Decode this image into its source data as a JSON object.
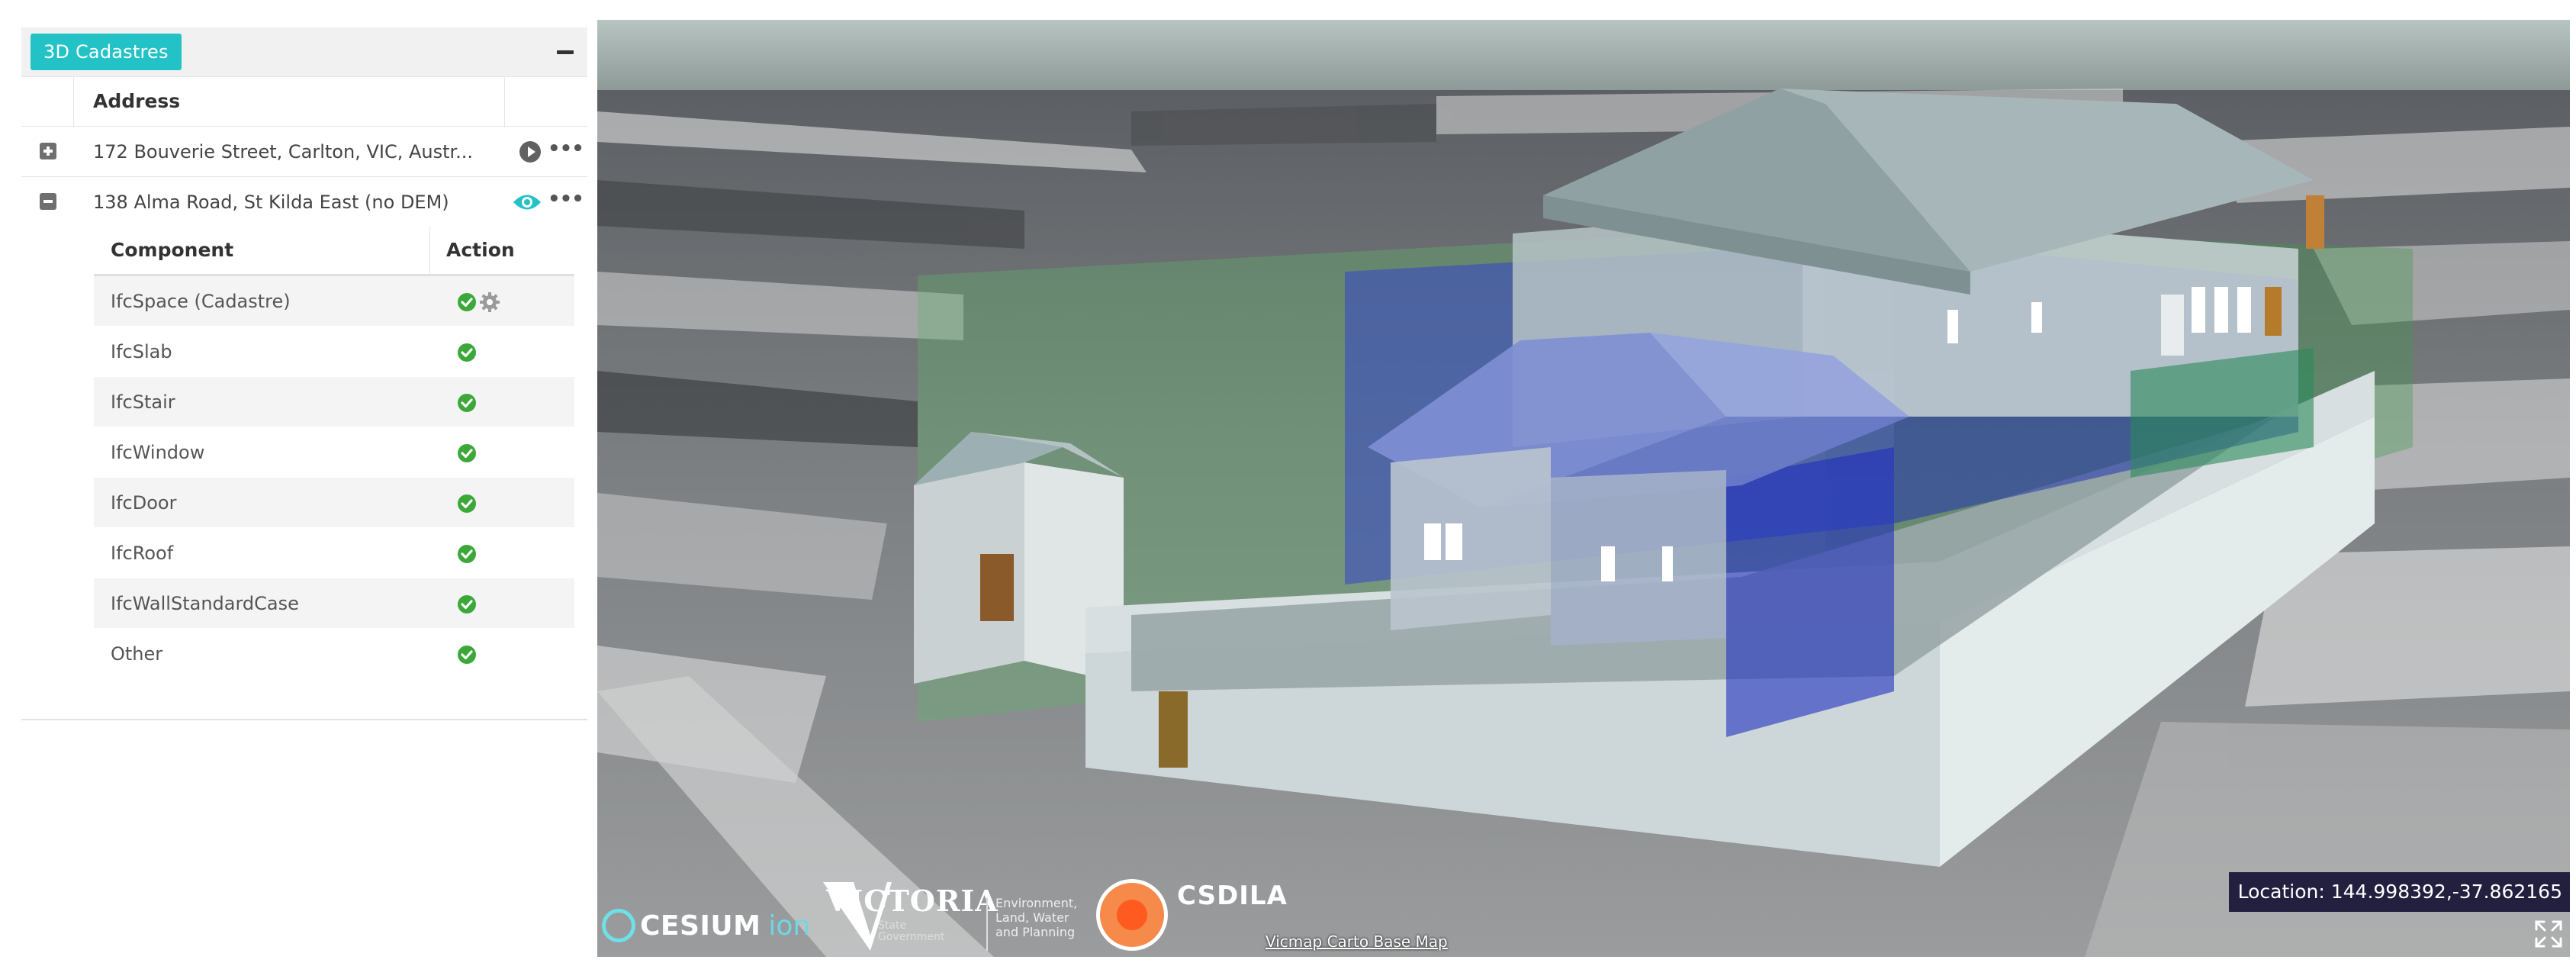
{
  "panel": {
    "title": "3D Cadastres",
    "address_column": "Address",
    "addresses": [
      {
        "label": "172 Bouverie Street, Carlton, VIC, Austr...",
        "expanded": false,
        "action_icon": "play-icon"
      },
      {
        "label": "138 Alma Road, St Kilda East (no DEM)",
        "expanded": true,
        "action_icon": "eye-icon"
      }
    ],
    "components": {
      "component_column": "Component",
      "action_column": "Action",
      "rows": [
        {
          "label": "IfcSpace (Cadastre)",
          "has_settings": true
        },
        {
          "label": "IfcSlab"
        },
        {
          "label": "IfcStair"
        },
        {
          "label": "IfcWindow"
        },
        {
          "label": "IfcDoor"
        },
        {
          "label": "IfcRoof"
        },
        {
          "label": "IfcWallStandardCase"
        },
        {
          "label": "Other"
        }
      ]
    }
  },
  "map": {
    "location": "Location: 144.998392,-37.862165",
    "credits": {
      "cesium": "CESIUM",
      "cesium_ion": "ion",
      "victoria": "VICTORIA",
      "victoria_sub": "State Government",
      "delwp": "Environment, Land, Water and Planning",
      "csdila": "CSDILA",
      "basemap": "Vicmap Carto Base Map"
    }
  },
  "colors": {
    "accent": "#23c2c6",
    "check": "#3da83a",
    "location_bg": "#23203f"
  }
}
